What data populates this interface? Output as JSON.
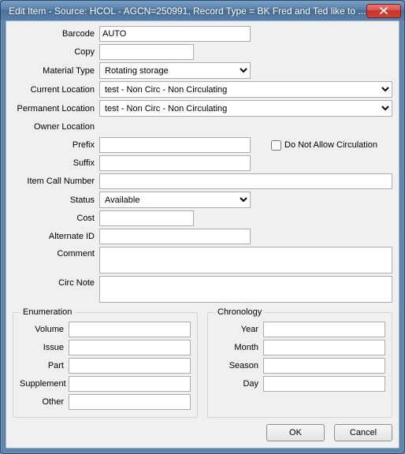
{
  "window": {
    "title": "Edit Item - Source: HCOL - AGCN=250991,  Record Type = BK Fred and Ted like to ..."
  },
  "labels": {
    "barcode": "Barcode",
    "copy": "Copy",
    "material_type": "Material Type",
    "current_location": "Current Location",
    "permanent_location": "Permanent Location",
    "owner_location": "Owner Location",
    "prefix": "Prefix",
    "suffix": "Suffix",
    "item_call_number": "Item Call Number",
    "status": "Status",
    "cost": "Cost",
    "alternate_id": "Alternate ID",
    "comment": "Comment",
    "circ_note": "Circ Note",
    "do_not_allow": "Do Not Allow Circulation",
    "enumeration": "Enumeration",
    "chronology": "Chronology",
    "volume": "Volume",
    "issue": "Issue",
    "part": "Part",
    "supplement": "Supplement",
    "other": "Other",
    "year": "Year",
    "month": "Month",
    "season": "Season",
    "day": "Day"
  },
  "values": {
    "barcode": "AUTO",
    "copy": "",
    "material_type": "Rotating storage",
    "current_location": "test - Non Circ - Non Circulating",
    "permanent_location": "test - Non Circ - Non Circulating",
    "owner_location": "",
    "prefix": "",
    "suffix": "",
    "item_call_number": "",
    "status": "Available",
    "cost": "",
    "alternate_id": "",
    "comment": "",
    "circ_note": "",
    "do_not_allow": false,
    "volume": "",
    "issue": "",
    "part": "",
    "supplement": "",
    "other": "",
    "year": "",
    "month": "",
    "season": "",
    "day": ""
  },
  "buttons": {
    "ok": "OK",
    "cancel": "Cancel"
  }
}
